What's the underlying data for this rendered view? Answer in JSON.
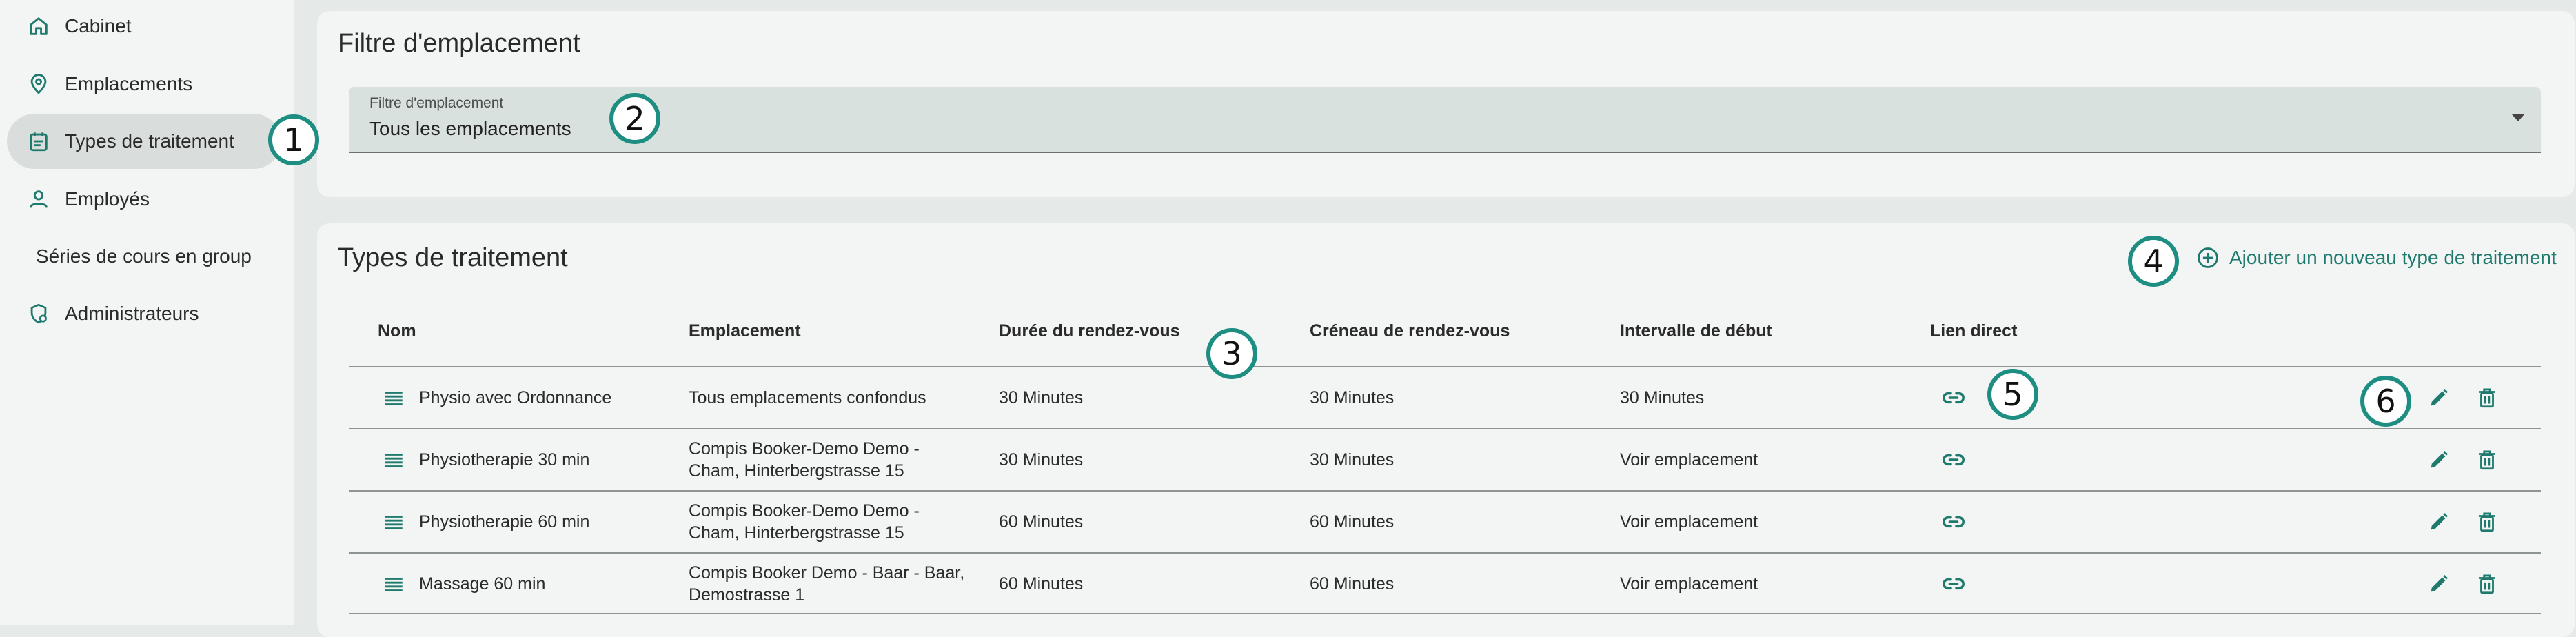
{
  "sidebar": {
    "items": [
      {
        "label": "Cabinet",
        "icon": "home-icon"
      },
      {
        "label": "Emplacements",
        "icon": "location-pin-icon"
      },
      {
        "label": "Types de traitement",
        "icon": "calendar-list-icon",
        "active": true
      },
      {
        "label": "Employés",
        "icon": "person-icon"
      },
      {
        "label": "Séries de cours en group",
        "icon": null
      },
      {
        "label": "Administrateurs",
        "icon": "admin-shield-icon"
      }
    ]
  },
  "filter_card": {
    "title": "Filtre d'emplacement",
    "select_label": "Filtre d'emplacement",
    "select_value": "Tous les emplacements"
  },
  "types_card": {
    "title": "Types de traitement",
    "add_label": "Ajouter un nouveau type de traitement",
    "columns": [
      "Nom",
      "Emplacement",
      "Durée du rendez-vous",
      "Créneau de rendez-vous",
      "Intervalle de début",
      "Lien direct"
    ],
    "rows": [
      {
        "name": "Physio avec Ordonnance",
        "location": "Tous emplacements confondus",
        "duration": "30 Minutes",
        "slot": "30 Minutes",
        "interval": "30 Minutes"
      },
      {
        "name": "Physiotherapie 30 min",
        "location": "Compis Booker-Demo Demo - Cham, Hinterbergstrasse 15",
        "duration": "30 Minutes",
        "slot": "30 Minutes",
        "interval": "Voir emplacement"
      },
      {
        "name": "Physiotherapie 60 min",
        "location": "Compis Booker-Demo Demo - Cham, Hinterbergstrasse 15",
        "duration": "60 Minutes",
        "slot": "60 Minutes",
        "interval": "Voir emplacement"
      },
      {
        "name": "Massage 60 min",
        "location": "Compis Booker Demo - Baar - Baar, Demostrasse 1",
        "duration": "60 Minutes",
        "slot": "60 Minutes",
        "interval": "Voir emplacement"
      }
    ]
  },
  "annotations": [
    "1",
    "2",
    "3",
    "4",
    "5",
    "6"
  ],
  "colors": {
    "accent": "#1f7a6e",
    "badge_ring": "#1e8d82",
    "background": "#e5eae8",
    "card": "#f2f5f4",
    "select_bg": "#d8e1dd"
  }
}
